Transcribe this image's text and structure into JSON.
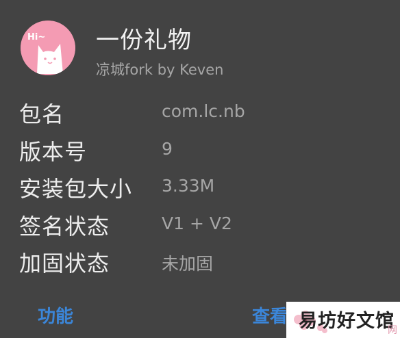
{
  "app": {
    "name": "一份礼物",
    "subtitle": "凉城fork by Keven",
    "avatar_text": "Hi~"
  },
  "info": [
    {
      "label": "包名",
      "value": "com.lc.nb"
    },
    {
      "label": "版本号",
      "value": "9"
    },
    {
      "label": "安装包大小",
      "value": "3.33M"
    },
    {
      "label": "签名状态",
      "value": "V1 + V2"
    },
    {
      "label": "加固状态",
      "value": "未加固"
    }
  ],
  "buttons": {
    "functions": "功能",
    "view": "查看"
  },
  "watermark": {
    "text": "易坊好文馆",
    "mark": "网"
  },
  "colors": {
    "background": "#434343",
    "accent": "#3b86d9",
    "avatar": "#f49bb3"
  }
}
